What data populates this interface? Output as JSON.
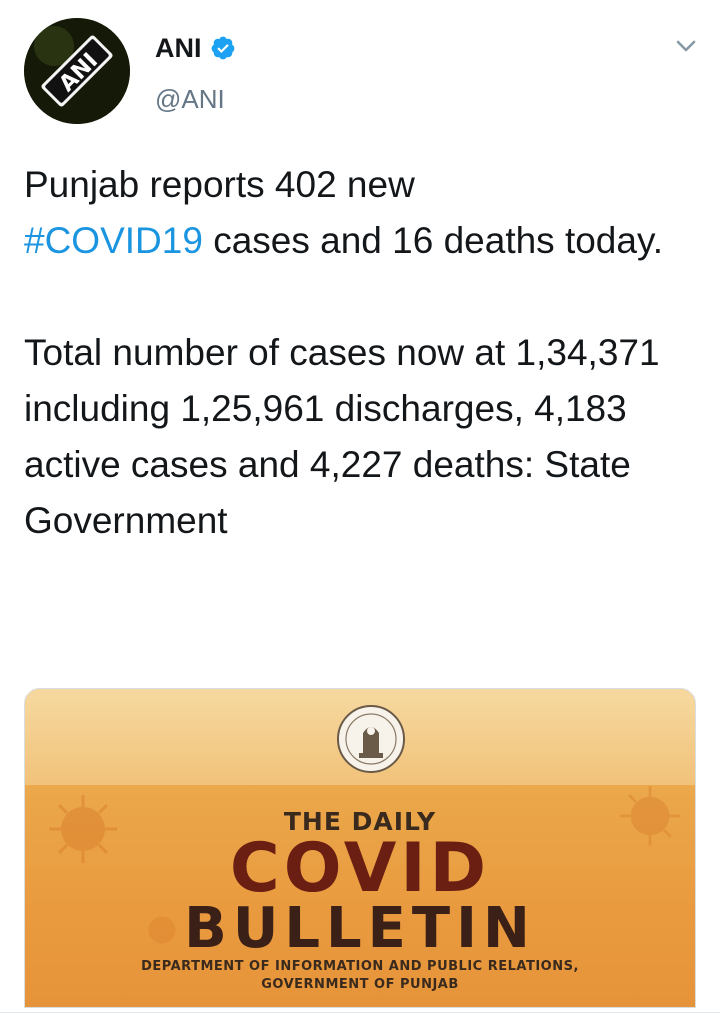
{
  "tweet": {
    "author": {
      "display_name": "ANI",
      "handle": "@ANI",
      "verified": true,
      "avatar_text": "ANI"
    },
    "text": {
      "line_a_prefix": "Punjab reports 402 new",
      "hashtag": "#COVID19",
      "line_a_suffix": " cases and 16 deaths today.",
      "paragraph_b": "Total number of cases now at 1,34,371 including 1,25,961 discharges, 4,183 active cases and 4,227 deaths: State Government"
    },
    "menu_icon": "chevron-down-icon",
    "media": {
      "heading_small": "THE DAILY",
      "heading_large": "COVID",
      "heading_word": "BULLETIN",
      "department": "DEPARTMENT OF INFORMATION AND PUBLIC RELATIONS,",
      "government": "GOVERNMENT OF PUNJAB",
      "emblem_icon": "state-emblem-seal"
    }
  },
  "colors": {
    "link": "#1b95e0",
    "text": "#14171a",
    "secondary": "#657786",
    "verified": "#1da1f2",
    "bulletin_bg": "#e99a3e",
    "bulletin_title": "#6b1e12"
  }
}
